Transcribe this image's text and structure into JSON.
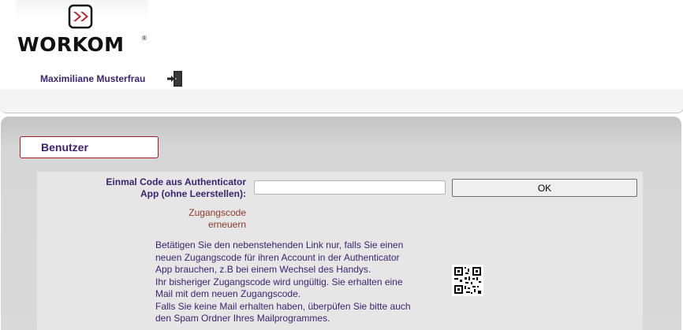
{
  "header": {
    "logo_text": "WORKOM",
    "logo_reg": "®",
    "user_name": "Maximiliane Musterfrau"
  },
  "section": {
    "title": "Benutzer"
  },
  "form": {
    "code_label_line1": "Einmal Code aus Authenticator",
    "code_label_line2": "App (ohne Leerstellen):",
    "code_value": "",
    "ok_label": "OK",
    "renew_line1": "Zugangscode",
    "renew_line2": "erneuern"
  },
  "info": {
    "lines": [
      "Betätigen Sie den nebenstehenden Link nur, falls Sie einen",
      "neuen Zugangscode für ihren Account in der Authenticator",
      "App brauchen, z.B bei einem Wechsel des Handys.",
      "Ihr bisheriger Zugangscode wird ungültig. Sie erhalten eine",
      "Mail mit dem neuen Zugangscode.",
      "Falls Sie keine Mail erhalten haben, überpüfen Sie bitte auch",
      "den Spam Ordner Ihres Mailprogrammes."
    ]
  },
  "colors": {
    "brand_red": "#b3262c",
    "text_purple": "#3a2570",
    "link_brown": "#8b3a2a"
  },
  "icons": {
    "logo": "workom-logo-icon",
    "logout": "logout-door-icon",
    "qr": "qr-code-icon"
  }
}
